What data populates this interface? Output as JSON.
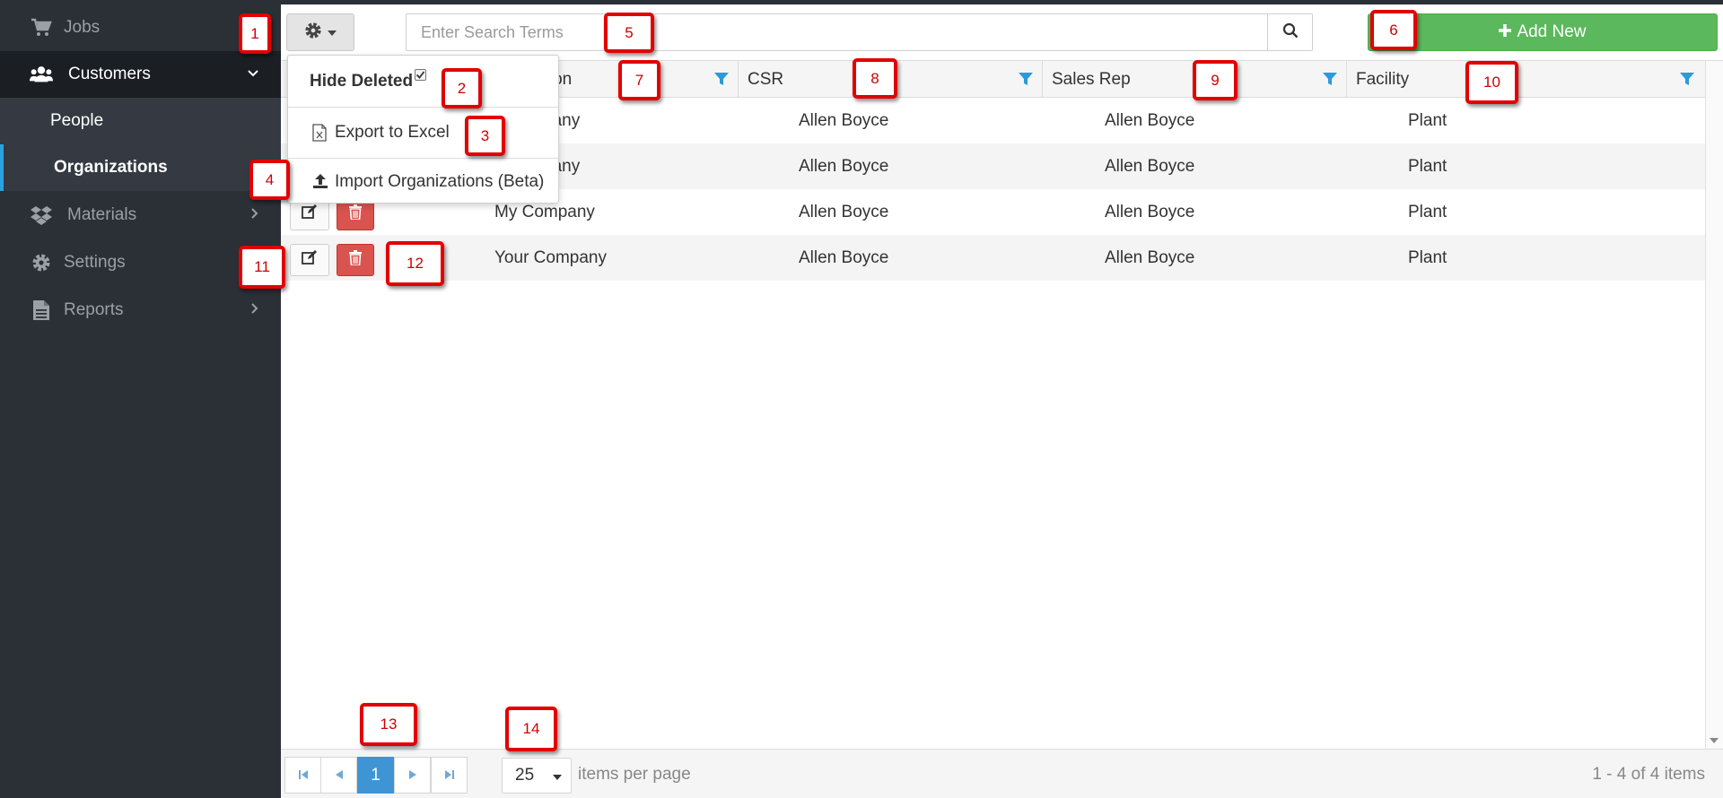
{
  "sidebar": {
    "items": [
      {
        "label": "Jobs",
        "icon": "shopping-cart-icon"
      },
      {
        "label": "Customers",
        "icon": "users-icon",
        "expanded": true
      },
      {
        "label": "People"
      },
      {
        "label": "Organizations",
        "selected": true
      },
      {
        "label": "Materials",
        "icon": "dropbox-icon"
      },
      {
        "label": "Settings",
        "icon": "gear-icon"
      },
      {
        "label": "Reports",
        "icon": "file-text-icon"
      }
    ]
  },
  "toolbar": {
    "settings_icon": "gear-icon",
    "search_placeholder": "Enter Search Terms",
    "search_icon": "search-icon",
    "add_label": "Add New",
    "add_color": "#5cb85c"
  },
  "menu": {
    "hide_deleted_label": "Hide Deleted",
    "hide_deleted_checked": true,
    "export_label": "Export to Excel",
    "import_label": "Import Organizations (Beta)"
  },
  "grid": {
    "columns": [
      "Organization",
      "CSR",
      "Sales Rep",
      "Facility"
    ],
    "header_visible_text": "ation",
    "rows": [
      {
        "organization": "My Company",
        "organization_visible": "pany",
        "csr": "Allen Boyce",
        "sales_rep": "Allen Boyce",
        "facility": "Plant"
      },
      {
        "organization": "Your Company",
        "organization_visible": "pany",
        "csr": "Allen Boyce",
        "sales_rep": "Allen Boyce",
        "facility": "Plant"
      },
      {
        "organization": "My Company",
        "csr": "Allen Boyce",
        "sales_rep": "Allen Boyce",
        "facility": "Plant"
      },
      {
        "organization": "Your Company",
        "csr": "Allen Boyce",
        "sales_rep": "Allen Boyce",
        "facility": "Plant"
      }
    ]
  },
  "pager": {
    "current_page": "1",
    "page_size": "25",
    "items_per_page_label": "items per page",
    "info": "1 - 4 of 4 items"
  },
  "callouts": [
    "1",
    "2",
    "3",
    "4",
    "5",
    "6",
    "7",
    "8",
    "9",
    "10",
    "11",
    "12",
    "13",
    "14"
  ]
}
